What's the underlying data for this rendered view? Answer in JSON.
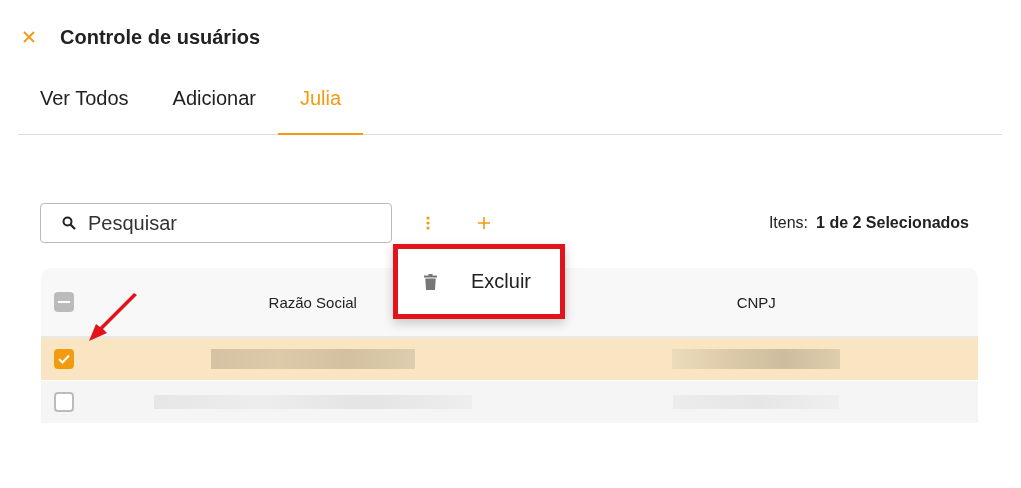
{
  "window": {
    "title": "Controle de usuários"
  },
  "tabs": [
    {
      "label": "Ver Todos",
      "selected": false
    },
    {
      "label": "Adicionar",
      "selected": false
    },
    {
      "label": "Julia",
      "selected": true
    }
  ],
  "search": {
    "placeholder": "Pesquisar"
  },
  "selection_summary": {
    "label": "Itens:",
    "value": "1 de 2 Selecionados"
  },
  "menu": {
    "items": [
      {
        "label": "Excluir",
        "highlighted": true
      }
    ]
  },
  "table": {
    "select_all_indeterminate": true,
    "columns": [
      "Razão Social",
      "CNPJ"
    ],
    "rows": [
      {
        "selected": true
      },
      {
        "selected": false
      }
    ]
  }
}
